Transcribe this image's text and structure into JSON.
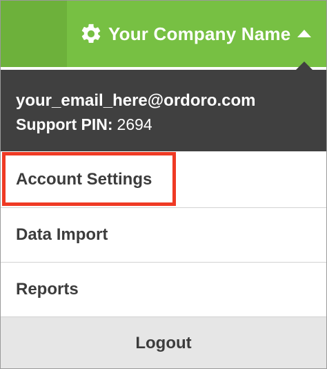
{
  "header": {
    "company_name": "Your Company Name",
    "colors": {
      "bar": "#77c043",
      "bar_left": "#6db13b"
    },
    "icons": {
      "settings": "gear-icon",
      "toggle": "caret-up-icon"
    }
  },
  "account": {
    "email": "your_email_here@ordoro.com",
    "pin_label": "Support PIN:",
    "pin_value": "2694"
  },
  "menu": {
    "items": [
      {
        "label": "Account Settings",
        "highlighted": true
      },
      {
        "label": "Data Import"
      },
      {
        "label": "Reports"
      }
    ],
    "logout_label": "Logout",
    "highlight_color": "#ef3a24"
  }
}
